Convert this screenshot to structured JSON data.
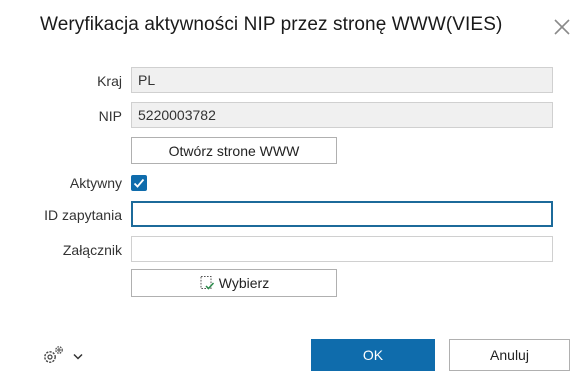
{
  "window": {
    "title": "Weryfikacja aktywności NIP przez stronę WWW(VIES)",
    "close_icon": "close-icon"
  },
  "form": {
    "kraj_label": "Kraj",
    "kraj_value": "PL",
    "nip_label": "NIP",
    "nip_value": "5220003782",
    "open_www_label": "Otwórz strone WWW",
    "aktywny_label": "Aktywny",
    "aktywny_checked": true,
    "id_zapytania_label": "ID zapytania",
    "id_zapytania_value": "",
    "zalacznik_label": "Załącznik",
    "zalacznik_value": "",
    "wybierz_label": "Wybierz"
  },
  "footer": {
    "ok_label": "OK",
    "cancel_label": "Anuluj",
    "settings_icon": "gear-icon"
  },
  "colors": {
    "accent": "#0f6cac",
    "focus_border": "#1c6a9a",
    "readonly_bg": "#f0f0f0"
  }
}
